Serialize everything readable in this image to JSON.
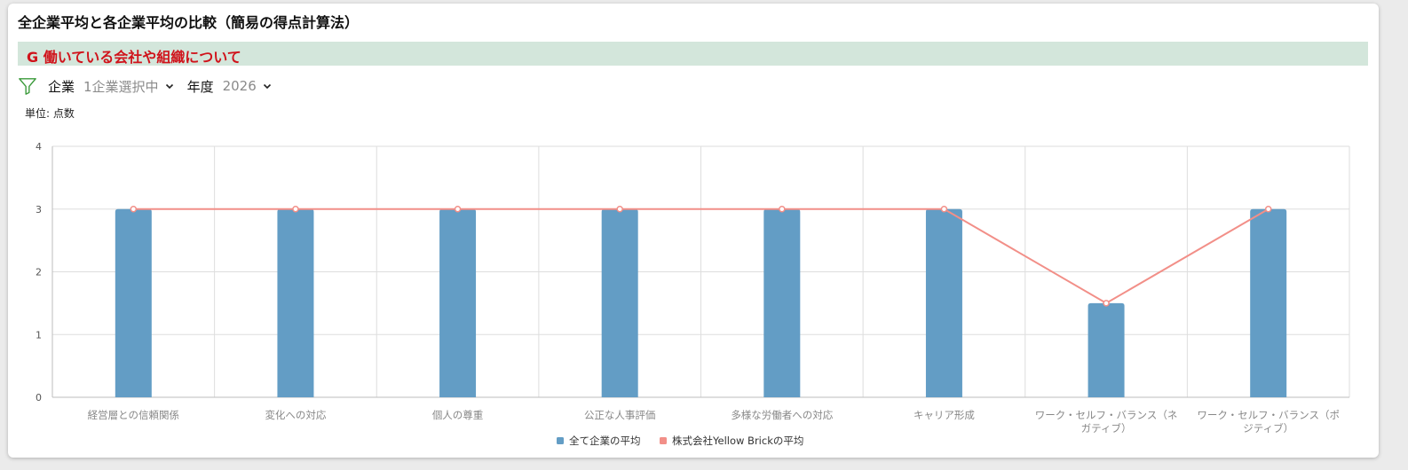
{
  "header": {
    "title": "全企業平均と各企業平均の比較（簡易の得点計算法）",
    "section_label": "G 働いている会社や組織について"
  },
  "filters": {
    "company_label": "企業",
    "company_value": "1企業選択中",
    "year_label": "年度",
    "year_value": "2026"
  },
  "unit_label": "単位: 点数",
  "colors": {
    "bar": "#639dc5",
    "line": "#f28f88",
    "section_bg": "#d3e6db",
    "section_text": "#d0131b"
  },
  "chart_data": {
    "type": "bar",
    "categories": [
      [
        "経営層との信頼関係"
      ],
      [
        "変化への対応"
      ],
      [
        "個人の尊重"
      ],
      [
        "公正な人事評価"
      ],
      [
        "多様な労働者への対応"
      ],
      [
        "キャリア形成"
      ],
      [
        "ワーク・セルフ・バランス（ネ",
        "ガティブ）"
      ],
      [
        "ワーク・セルフ・バランス（ポ",
        "ジティブ）"
      ]
    ],
    "series": [
      {
        "name": "全て企業の平均",
        "type": "bar",
        "values": [
          3,
          3,
          3,
          3,
          3,
          3,
          1.5,
          3
        ]
      },
      {
        "name": "株式会社Yellow Brickの平均",
        "type": "line",
        "values": [
          3,
          3,
          3,
          3,
          3,
          3,
          1.5,
          3
        ]
      }
    ],
    "ylim": [
      0,
      4
    ],
    "yticks": [
      0,
      1,
      2,
      3,
      4
    ],
    "grid": true,
    "legend": "bottom-center"
  }
}
